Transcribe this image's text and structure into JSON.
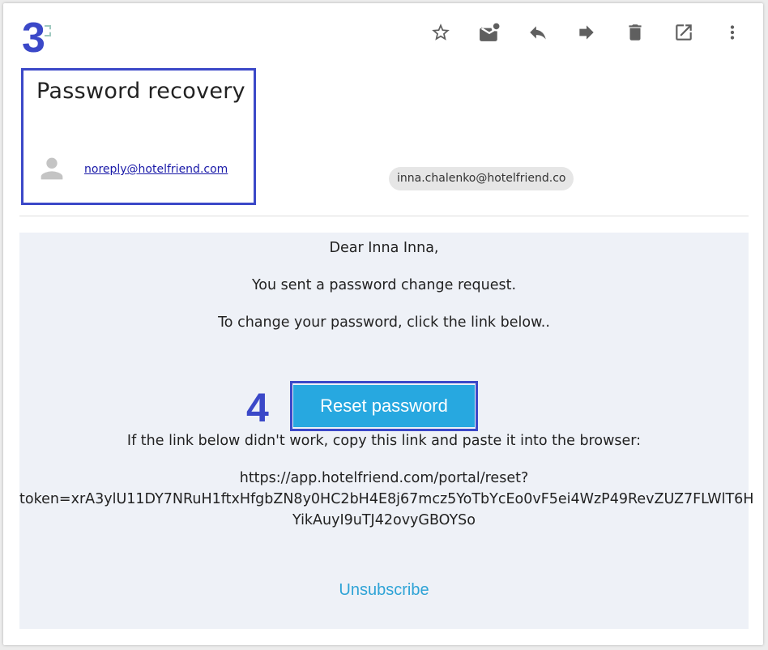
{
  "annotations": {
    "step_top": "3",
    "step_button": "4"
  },
  "toolbar": {
    "icons": [
      "star-icon",
      "mark-unread-icon",
      "reply-icon",
      "forward-icon",
      "delete-icon",
      "open-in-new-window-icon",
      "more-vert-icon"
    ]
  },
  "email": {
    "subject": "Password recovery",
    "sender": "noreply@hotelfriend.com",
    "recipient": "inna.chalenko@hotelfriend.co"
  },
  "body": {
    "greeting": "Dear Inna Inna,",
    "line1": "You sent a password change request.",
    "line2": "To change your password, click the link below..",
    "button_label": "Reset password",
    "fallback_text": "If the link below didn't work, copy this link and paste it into the browser:",
    "url_line1": "https://app.hotelfriend.com/portal/reset?",
    "url_line2": "token=xrA3ylU11DY7NRuH1ftxHfgbZN8y0HC2bH4E8j67mcz5YoTbYcEo0vF5ei4WzP49RevZUZ7FLWlT6H",
    "url_line3": "YikAuyI9uTJ42ovyGBOYSo",
    "unsubscribe": "Unsubscribe"
  },
  "colors": {
    "annotation": "#3b48c8",
    "button": "#27a8e0",
    "link": "#2ea3d6",
    "panel": "#eef1f7"
  }
}
